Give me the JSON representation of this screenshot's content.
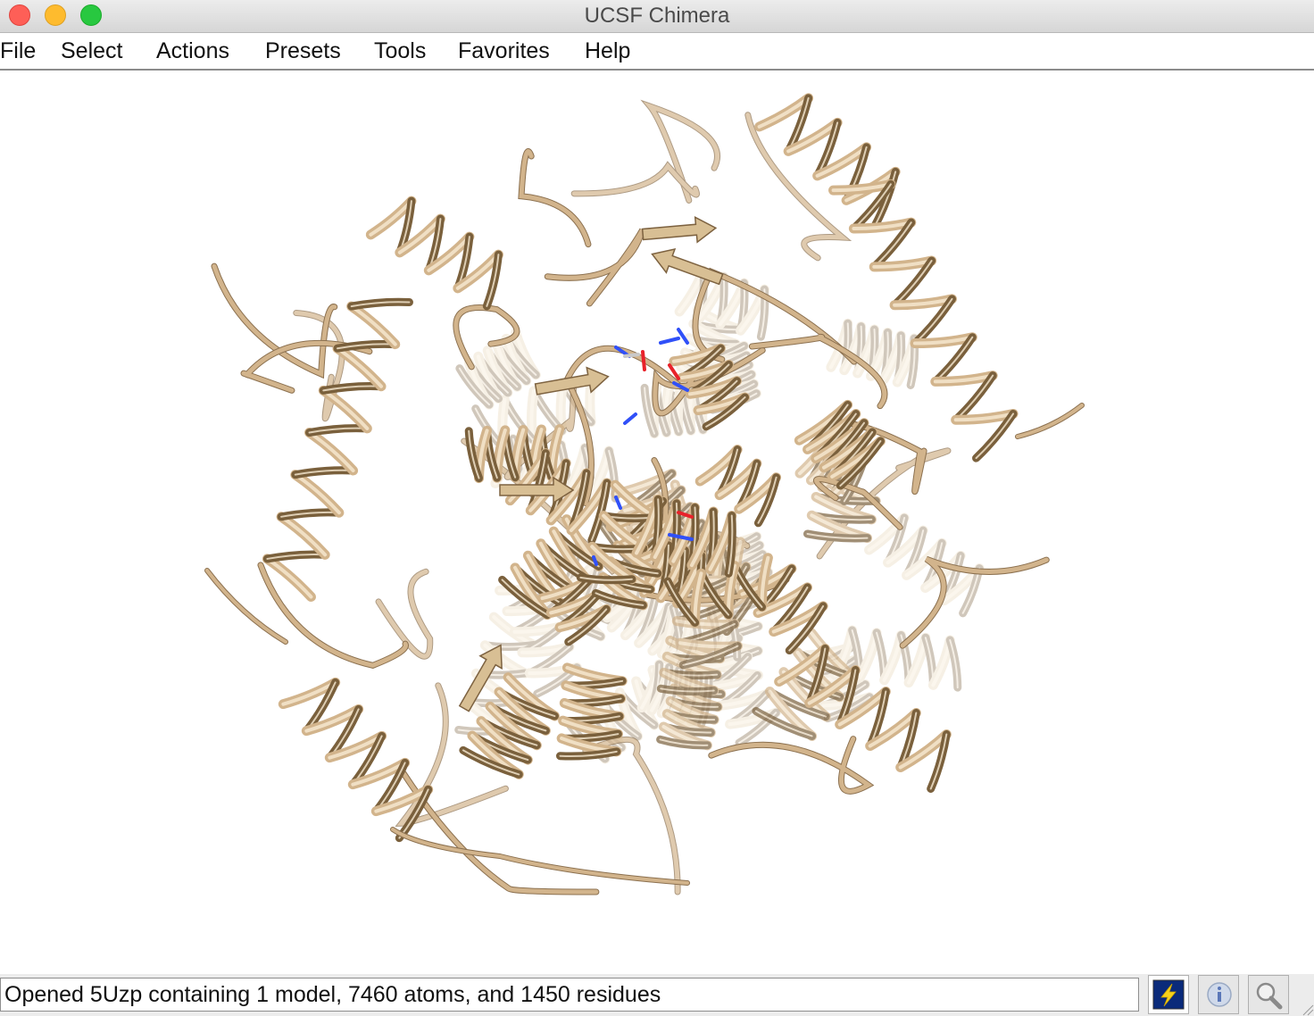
{
  "window": {
    "title": "UCSF Chimera"
  },
  "menubar": {
    "items": [
      "File",
      "Select",
      "Actions",
      "Presets",
      "Tools",
      "Favorites",
      "Help"
    ]
  },
  "viewer": {
    "background_color": "#ffffff",
    "ribbon_color": "#d2b48c",
    "atom_colors": {
      "nitrogen": "#3050f8",
      "oxygen": "#e8222a"
    }
  },
  "status": {
    "message": "Opened 5Uzp containing 1 model, 7460 atoms, and 1450 residues"
  },
  "toolbar_icons": [
    "lightning-icon",
    "info-icon",
    "magnifier-icon"
  ],
  "colors": {
    "close": "#fe5f57",
    "minimize": "#febb2e",
    "maximize": "#28c840",
    "lightning_button_bg": "#0a2a7a"
  }
}
